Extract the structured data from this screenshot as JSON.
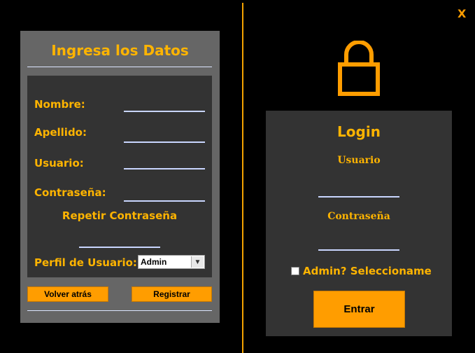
{
  "register": {
    "title": "Ingresa los Datos",
    "fields": {
      "nombre_label": "Nombre:",
      "apellido_label": "Apellido:",
      "usuario_label": "Usuario:",
      "contrasena_label": "Contraseña:",
      "repetir_label": "Repetir Contraseña",
      "perfil_label": "Perfil de Usuario:"
    },
    "perfil_selected": "Admin",
    "back_button": "Volver atrás",
    "register_button": "Registrar"
  },
  "login": {
    "close": "X",
    "title": "Login",
    "usuario_label": "Usuario",
    "contrasena_label": "Contraseña",
    "admin_checkbox_label": "Admin? Seleccioname",
    "enter_button": "Entrar"
  },
  "colors": {
    "accent": "#ffb400",
    "button": "#ff9d00",
    "panel_dark": "#333333",
    "panel_gray": "#666666"
  },
  "icons": [
    "lock-icon",
    "chevron-down-icon",
    "close-icon"
  ]
}
